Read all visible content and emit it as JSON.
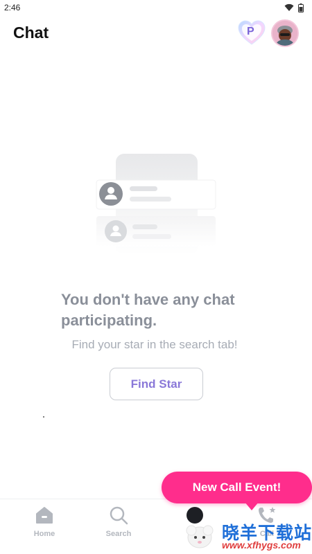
{
  "status_bar": {
    "time": "2:46"
  },
  "header": {
    "title": "Chat",
    "premium_badge_letter": "P"
  },
  "empty_state": {
    "title": "You don't have any chat participating.",
    "subtitle": "Find your star in the search tab!",
    "button_label": "Find Star"
  },
  "bottom_nav": {
    "items": [
      {
        "label": "Home",
        "icon": "home-icon"
      },
      {
        "label": "Search",
        "icon": "search-icon"
      },
      {
        "label": "",
        "icon": "star-avatar-icon"
      },
      {
        "label": "Call",
        "icon": "call-star-icon"
      }
    ]
  },
  "promo": {
    "label": "New Call Event!",
    "color": "#ff2d8c"
  },
  "watermark": {
    "brand": "晓羊下载站",
    "url": "www.xfhygs.com"
  },
  "colors": {
    "accent": "#8a78d8",
    "muted_text": "#8a8f99",
    "nav_text": "#b3b7be"
  }
}
